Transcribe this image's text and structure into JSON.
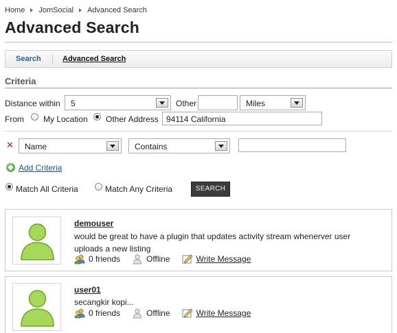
{
  "breadcrumb": {
    "items": [
      "Home",
      "JomSocial",
      "Advanced Search"
    ]
  },
  "page": {
    "title": "Advanced Search"
  },
  "tabs": {
    "search": "Search",
    "advanced": "Advanced Search"
  },
  "criteria": {
    "heading": "Criteria",
    "distance_label": "Distance within",
    "distance_value": "5",
    "other_label": "Other",
    "other_value": "",
    "unit_value": "Miles",
    "from_label": "From",
    "my_location_label": "My Location",
    "other_address_label": "Other Address",
    "address_value": "94114 California",
    "from_selected": "other_address",
    "field_value": "Name",
    "condition_value": "Contains",
    "criteria_value": "",
    "add_criteria_label": "Add Criteria",
    "match_all_label": "Match All Criteria",
    "match_any_label": "Match Any Criteria",
    "match_selected": "all",
    "search_button": "SEARCH"
  },
  "results": [
    {
      "username": "demouser",
      "status": "would be great to have a plugin that updates activity stream whenerver user uploads a new listing",
      "friends": "0 friends",
      "online": "Offline",
      "write": "Write Message"
    },
    {
      "username": "user01",
      "status": "secangkir kopi...",
      "friends": "0 friends",
      "online": "Offline",
      "write": "Write Message"
    }
  ],
  "icons": {
    "avatar": "default-user-avatar-icon",
    "friends": "friends-icon",
    "offline": "offline-user-icon",
    "write": "write-message-icon",
    "remove": "remove-criteria-icon",
    "add": "add-criteria-icon"
  },
  "colors": {
    "link_blue": "#1f5fa0",
    "avatar_green": "#7bbd2a",
    "remove_red": "#b21e1e",
    "button_dark": "#3c3c3c"
  }
}
